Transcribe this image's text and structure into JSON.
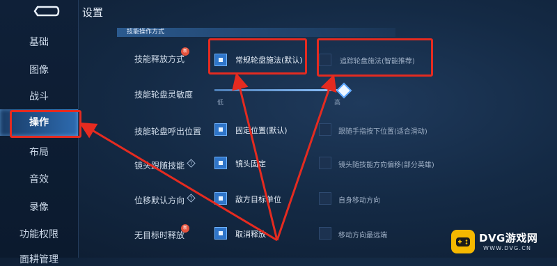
{
  "header": {
    "title": "设置"
  },
  "sidebar": {
    "items": [
      {
        "label": "基础"
      },
      {
        "label": "图像"
      },
      {
        "label": "战斗"
      },
      {
        "label": "操作"
      },
      {
        "label": "布局"
      },
      {
        "label": "音效"
      },
      {
        "label": "录像"
      },
      {
        "label": "功能权限"
      },
      {
        "label": "面耕管理"
      }
    ],
    "active_index": 3
  },
  "section": {
    "title": "技能操作方式"
  },
  "rows": [
    {
      "label": "技能释放方式",
      "new_badge": "新",
      "options": [
        {
          "label": "常规轮盘施法(默认)",
          "checked": true
        },
        {
          "label": "追踪轮盘施法(智能推荐)",
          "checked": false
        }
      ]
    },
    {
      "label": "技能轮盘灵敏度",
      "slider": {
        "min_label": "低",
        "max_label": "高",
        "value": 1.0
      }
    },
    {
      "label": "技能轮盘呼出位置",
      "options": [
        {
          "label": "固定位置(默认)",
          "checked": true
        },
        {
          "label": "跟随手指按下位置(适合滑动)",
          "checked": false
        }
      ]
    },
    {
      "label": "镜头跟随技能",
      "options": [
        {
          "label": "镜头固定",
          "checked": true
        },
        {
          "label": "镜头随技能方向偏移(部分英雄)",
          "checked": false
        }
      ]
    },
    {
      "label": "位移默认方向",
      "options": [
        {
          "label": "敌方目标单位",
          "checked": true
        },
        {
          "label": "自身移动方向",
          "checked": false
        }
      ]
    },
    {
      "label": "无目标时释放",
      "new_badge": "新",
      "options": [
        {
          "label": "取消释放",
          "checked": true
        },
        {
          "label": "移动方向最远端",
          "checked": false
        }
      ]
    }
  ],
  "watermark": {
    "main": "DVG游戏网",
    "sub": "WWW.DVG.CN"
  },
  "colors": {
    "accent": "#2f75c9",
    "highlight_box": "#e52b20",
    "watermark": "#f5b800"
  }
}
